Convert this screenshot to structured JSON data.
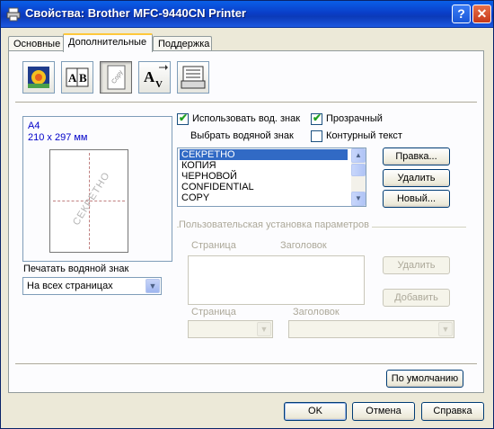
{
  "window": {
    "title": "Свойства: Brother MFC-9440CN Printer",
    "help_label": "?",
    "close_label": "✕"
  },
  "tabs": [
    {
      "label": "Основные"
    },
    {
      "label": "Дополнительные"
    },
    {
      "label": "Поддержка"
    }
  ],
  "toolbar_icons": [
    {
      "name": "color-settings-icon"
    },
    {
      "name": "scaling-icon",
      "glyph": "A|B"
    },
    {
      "name": "watermark-icon",
      "glyph": "Copy"
    },
    {
      "name": "page-setting-icon",
      "glyph": "A"
    },
    {
      "name": "device-options-icon"
    }
  ],
  "preview": {
    "paper_name": "A4",
    "paper_size": "210 x 297 мм",
    "watermark_text": "СЕКРЕТНО"
  },
  "print_watermark": {
    "label": "Печатать водяной знак",
    "selected": "На всех страницах"
  },
  "watermark": {
    "use_label": "Использовать вод. знак",
    "use_checked": true,
    "transparent_label": "Прозрачный",
    "transparent_checked": true,
    "outline_label": "Контурный текст",
    "outline_checked": false,
    "select_label": "Выбрать водяной знак",
    "items": [
      "СЕКРЕТНО",
      "КОПИЯ",
      "ЧЕРНОВОЙ",
      "CONFIDENTIAL",
      "COPY"
    ],
    "selected_index": 0,
    "edit_button": "Правка...",
    "delete_button": "Удалить",
    "new_button": "Новый..."
  },
  "custom": {
    "group_label": "Пользовательская установка параметров",
    "page_col": "Страница",
    "header_col": "Заголовок",
    "delete_button": "Удалить",
    "add_button": "Добавить",
    "page_label": "Страница",
    "header_label": "Заголовок"
  },
  "default_button": "По умолчанию",
  "footer": {
    "ok": "OK",
    "cancel": "Отмена",
    "help": "Справка"
  },
  "colors": {
    "title_bar": "#0a3fc9",
    "selection": "#316ac5",
    "paper_label": "#0000c8"
  }
}
